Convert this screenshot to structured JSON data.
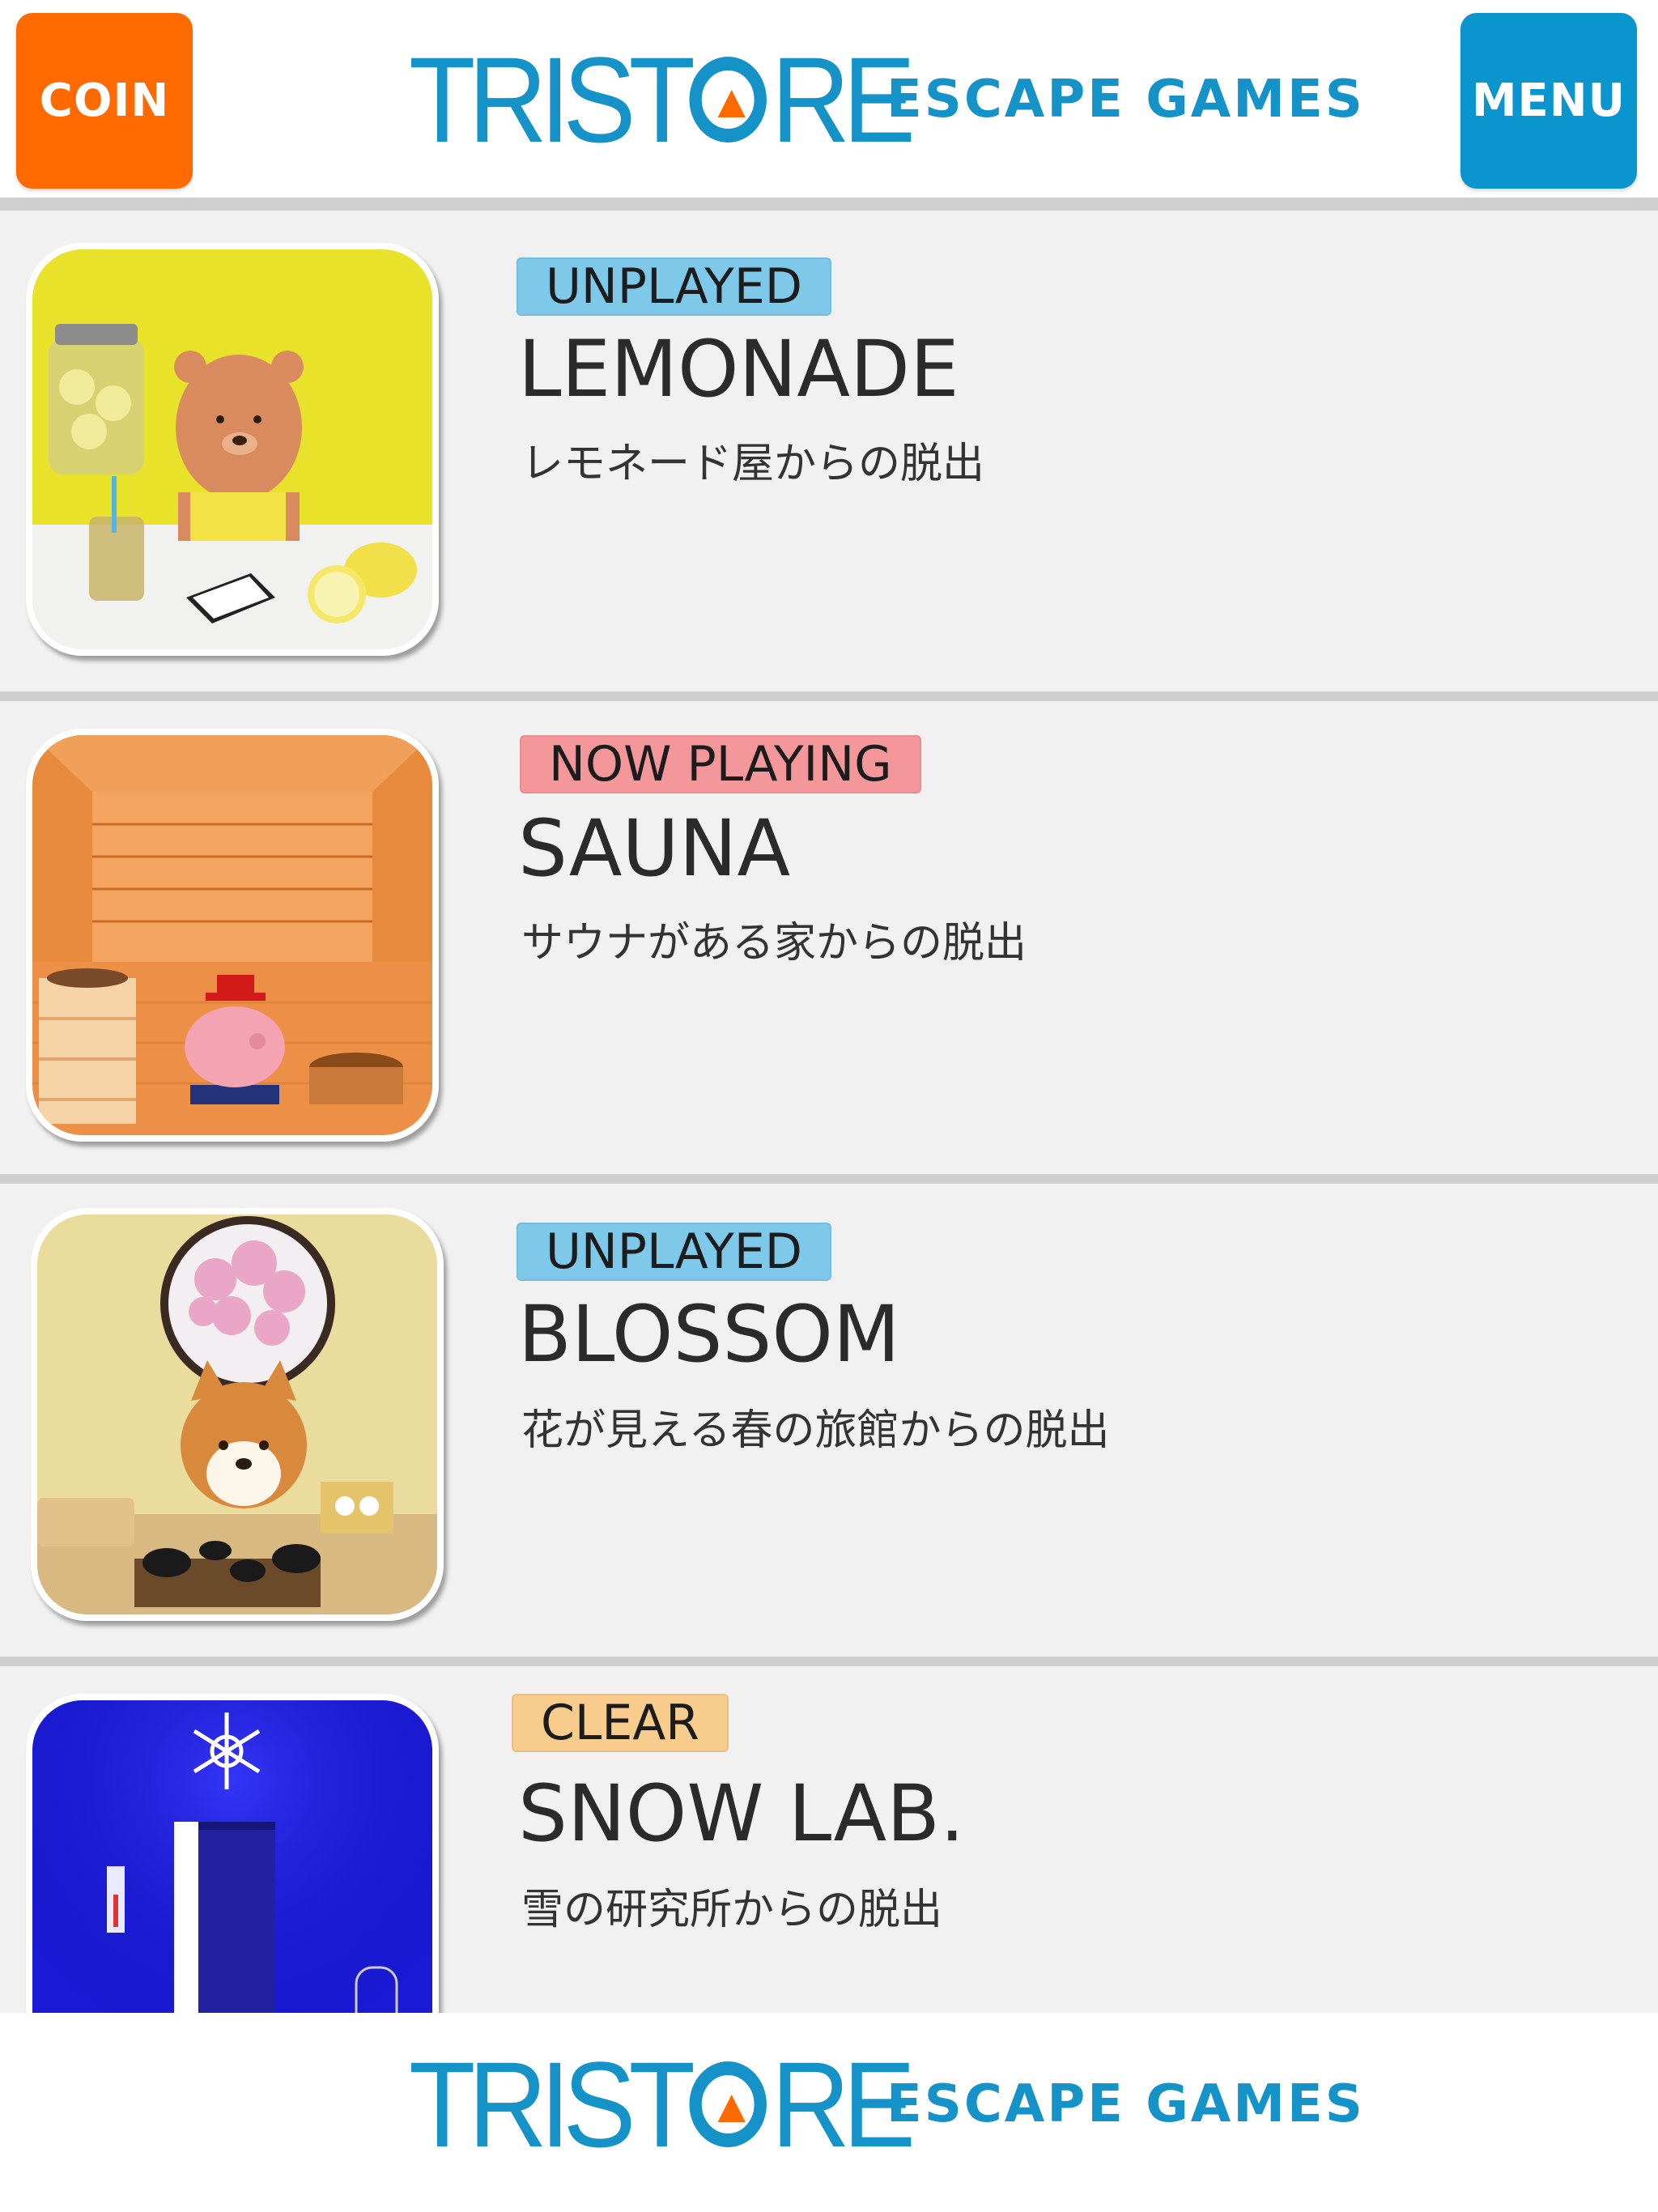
{
  "header": {
    "coin_label": "COIN",
    "menu_label": "MENU",
    "logo_text_left": "TRIST",
    "logo_text_right": "RE",
    "tagline": "ESCAPE GAMES"
  },
  "colors": {
    "coin": "#ff6a00",
    "menu": "#0a95cf",
    "brand": "#1592c8",
    "logo_triangle": "#ff6a00",
    "badge_unplayed": "#7ec8ea",
    "badge_now_playing": "#f3979a",
    "badge_clear": "#f7cc8c"
  },
  "games": [
    {
      "status": "UNPLAYED",
      "status_type": "unplayed",
      "title": "LEMONADE",
      "subtitle": "レモネード屋からの脱出",
      "thumbnail": "lemonade-scene"
    },
    {
      "status": "NOW PLAYING",
      "status_type": "now_playing",
      "title": "SAUNA",
      "subtitle": "サウナがある家からの脱出",
      "thumbnail": "sauna-scene"
    },
    {
      "status": "UNPLAYED",
      "status_type": "unplayed",
      "title": "BLOSSOM",
      "subtitle": "花が見える春の旅館からの脱出",
      "thumbnail": "blossom-scene"
    },
    {
      "status": "CLEAR",
      "status_type": "clear",
      "title": "SNOW LAB.",
      "subtitle": "雪の研究所からの脱出",
      "thumbnail": "snow-lab-scene"
    }
  ],
  "footer": {
    "logo_text_left": "TRIST",
    "logo_text_right": "RE",
    "tagline": "ESCAPE GAMES"
  }
}
